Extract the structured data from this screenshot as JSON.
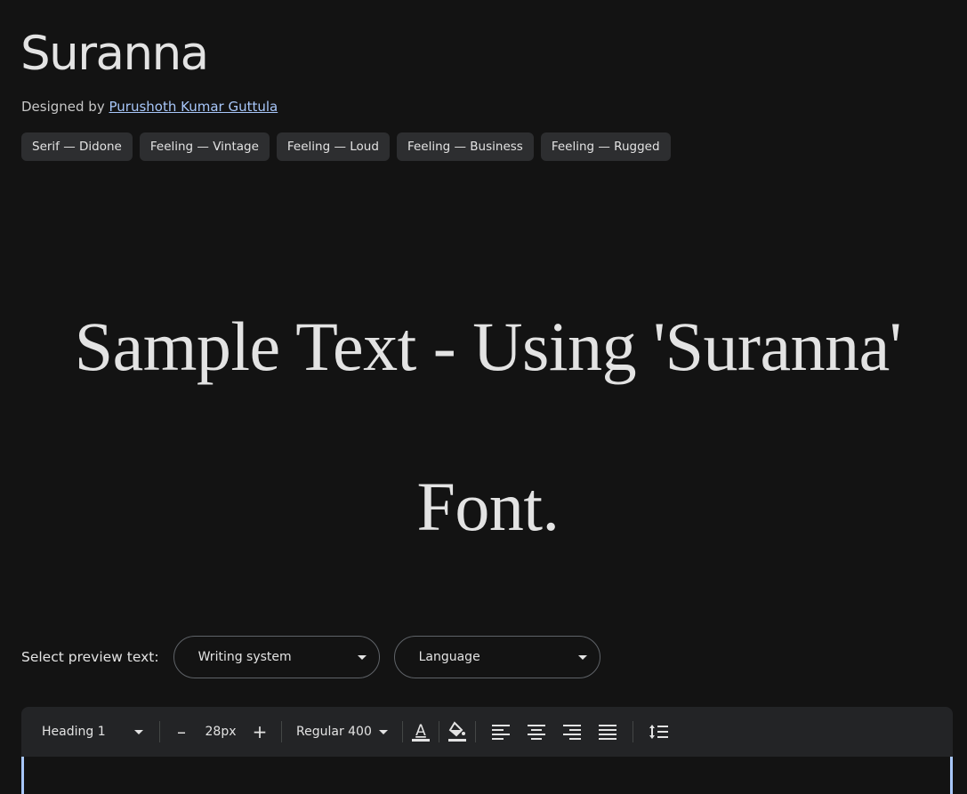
{
  "font": {
    "name": "Suranna",
    "designed_by_prefix": "Designed by",
    "designer": "Purushoth Kumar Guttula"
  },
  "tags": [
    "Serif — Didone",
    "Feeling — Vintage",
    "Feeling — Loud",
    "Feeling — Business",
    "Feeling — Rugged"
  ],
  "sample_text": "Sample Text - Using 'Suranna' Font.",
  "preview": {
    "label": "Select preview text:",
    "writing_system": "Writing system",
    "language": "Language"
  },
  "toolbar": {
    "style": "Heading 1",
    "decrease": "–",
    "size": "28px",
    "increase": "+",
    "weight": "Regular 400"
  },
  "icons": {
    "text_color": "text-color-icon",
    "highlight": "fill-color-icon",
    "align_left": "align-left-icon",
    "align_center": "align-center-icon",
    "align_right": "align-right-icon",
    "justify": "align-justify-icon",
    "line_height": "line-height-icon"
  },
  "colors": {
    "background": "#131313",
    "link": "#a8c7fa",
    "chip": "#2d2e30",
    "toolbar": "#232426"
  }
}
